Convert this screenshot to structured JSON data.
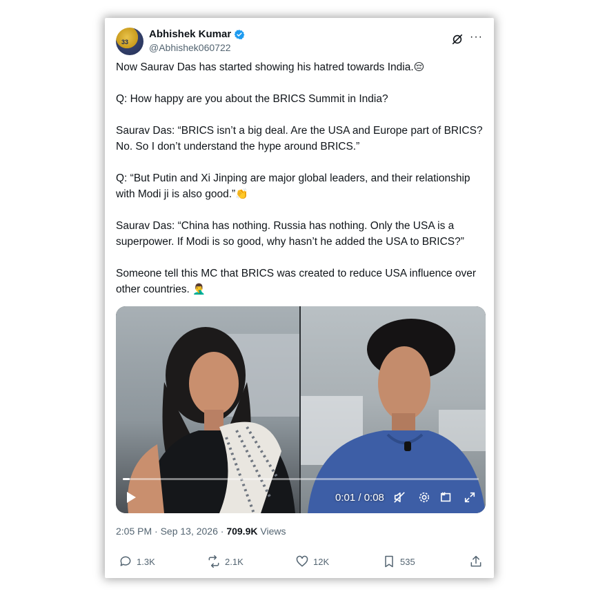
{
  "author": {
    "display_name": "Abhishek Kumar",
    "handle": "@Abhishek060722",
    "avatar_text": "33"
  },
  "tweet": {
    "paragraphs": [
      {
        "text": "Now Saurav Das has started showing his hatred towards India.",
        "emoji": "😔"
      },
      {
        "text": "Q: How happy are you about the BRICS Summit in India?"
      },
      {
        "text": "Saurav Das: “BRICS isn’t a big deal. Are the USA and Europe part of BRICS? No. So I don’t understand the hype around BRICS.”"
      },
      {
        "text": "Q: “But Putin and Xi Jinping are major global leaders, and their relationship with Modi ji is also good.”",
        "emoji": "👏"
      },
      {
        "text": "Saurav Das: “China has nothing. Russia has nothing. Only the USA is a superpower. If Modi is so good, why hasn’t he added the USA to BRICS?”"
      },
      {
        "text": "Someone tell this MC that BRICS was created to reduce USA influence over other countries.",
        "emoji": "🤦‍♂️"
      }
    ]
  },
  "video": {
    "time": "0:01 / 0:08",
    "progress": 0.02
  },
  "meta": {
    "timestamp": "2:05 PM · Sep 13, 2026 · ",
    "views_count": "709.9K",
    "views_label": " Views"
  },
  "actions": {
    "replies": "1.3K",
    "reposts": "2.1K",
    "likes": "12K",
    "bookmarks": "535"
  },
  "colors": {
    "verified": "#1d9bf0",
    "text_primary": "#0f1419",
    "text_secondary": "#536471"
  }
}
